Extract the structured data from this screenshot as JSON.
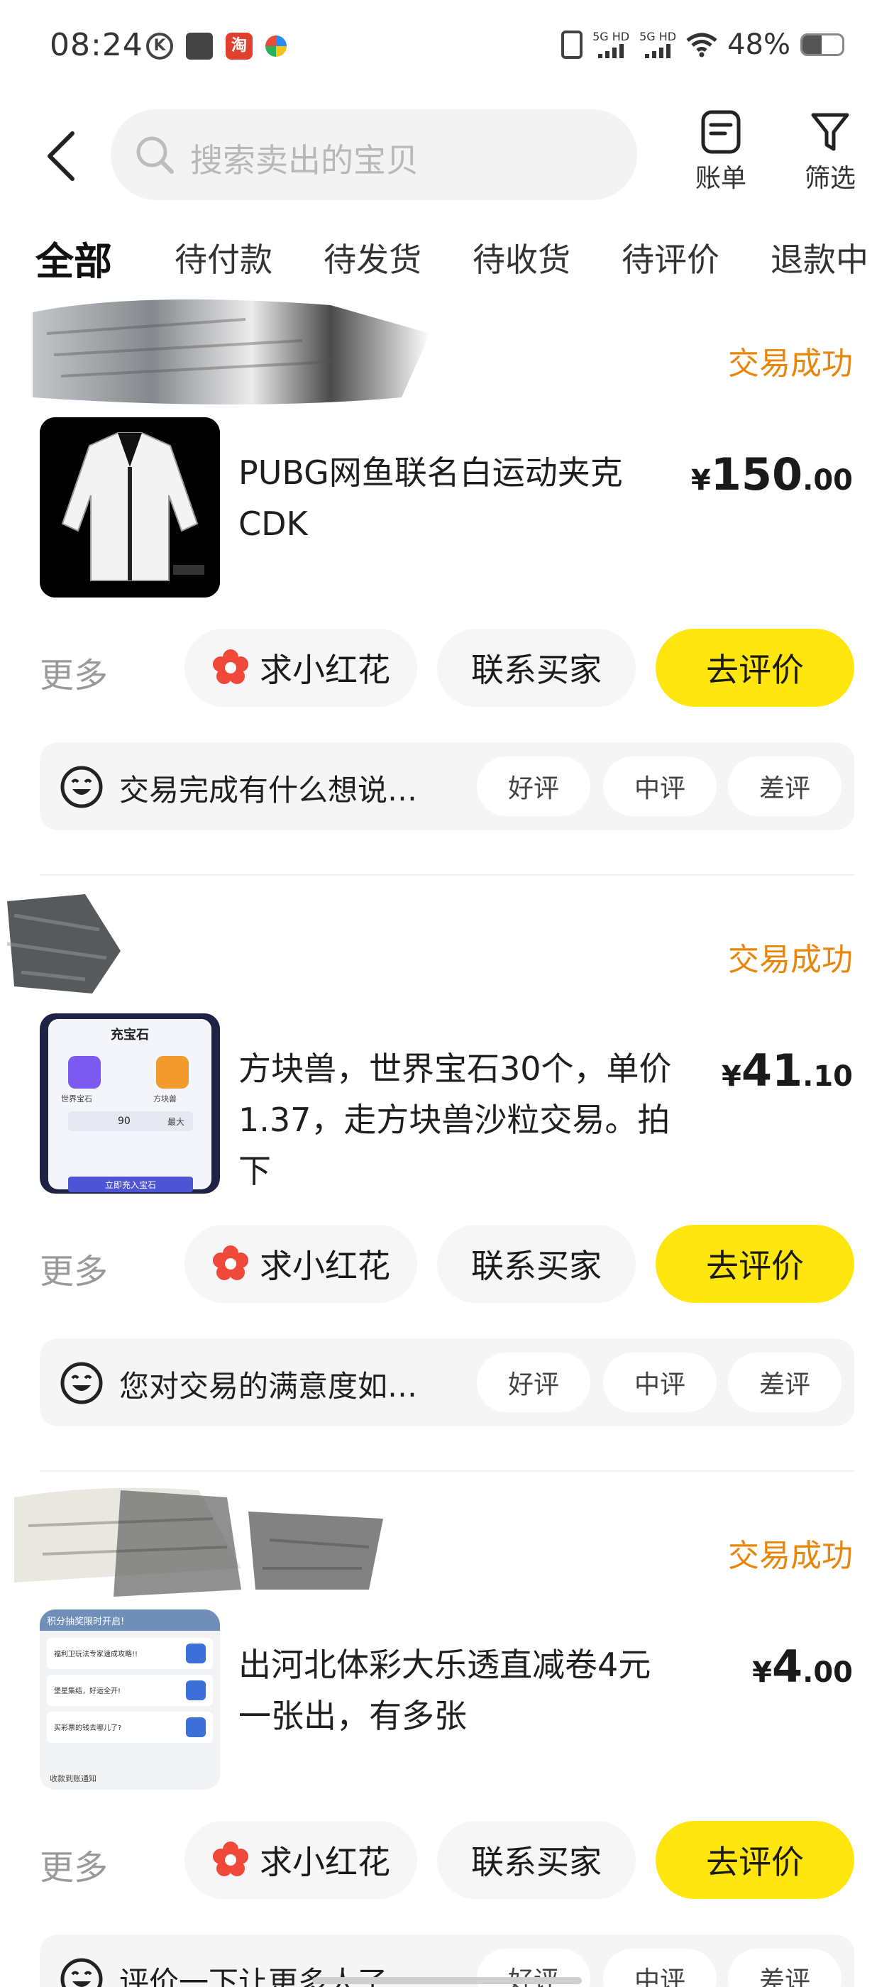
{
  "status_bar": {
    "time": "08:24",
    "network_1": "5G HD",
    "network_2": "5G HD",
    "battery_percent": "48%",
    "battery_level": 0.48,
    "taobao_glyph": "淘"
  },
  "header": {
    "search_placeholder": "搜索卖出的宝贝",
    "bill_label": "账单",
    "filter_label": "筛选"
  },
  "tabs": [
    {
      "label": "全部",
      "active": true
    },
    {
      "label": "待付款"
    },
    {
      "label": "待发货"
    },
    {
      "label": "待收货"
    },
    {
      "label": "待评价"
    },
    {
      "label": "退款中"
    }
  ],
  "orders": [
    {
      "status": "交易成功",
      "title": "PUBG网鱼联名白运动夹克CDK",
      "price_currency": "¥",
      "price_int": "150",
      "price_dec": ".00",
      "more": "更多",
      "flower_btn": "求小红花",
      "contact_btn": "联系买家",
      "review_btn": "去评价",
      "feedback_prompt": "交易完成有什么想说…",
      "rate_good": "好评",
      "rate_mid": "中评",
      "rate_bad": "差评"
    },
    {
      "status": "交易成功",
      "title": "方块兽，世界宝石30个，单价1.37，走方块兽沙粒交易。拍下",
      "price_currency": "¥",
      "price_int": "41",
      "price_dec": ".10",
      "more": "更多",
      "flower_btn": "求小红花",
      "contact_btn": "联系买家",
      "review_btn": "去评价",
      "feedback_prompt": "您对交易的满意度如…",
      "rate_good": "好评",
      "rate_mid": "中评",
      "rate_bad": "差评",
      "thumb_title": "充宝石",
      "thumb_label_left": "世界宝石",
      "thumb_label_right": "方块兽",
      "thumb_qty": "90",
      "thumb_max": "最大",
      "thumb_button": "立即充入宝石"
    },
    {
      "status": "交易成功",
      "title": "出河北体彩大乐透直减卷4元一张出，有多张",
      "price_currency": "¥",
      "price_int": "4",
      "price_dec": ".00",
      "more": "更多",
      "flower_btn": "求小红花",
      "contact_btn": "联系买家",
      "review_btn": "去评价",
      "feedback_prompt": "评价一下让更多人了…",
      "rate_good": "好评",
      "rate_mid": "中评",
      "rate_bad": "差评",
      "thumb_banner": "积分抽奖限时开启!",
      "thumb_lines": [
        "福利卫玩法专家速成攻略!!",
        "堡星集结，好运全开!",
        "买彩票的钱去哪儿了?"
      ],
      "thumb_footer": "收款到账通知"
    }
  ],
  "colors": {
    "accent_yellow": "#ffe60f",
    "status_orange": "#e8860c",
    "flower_red": "#f0493a"
  }
}
